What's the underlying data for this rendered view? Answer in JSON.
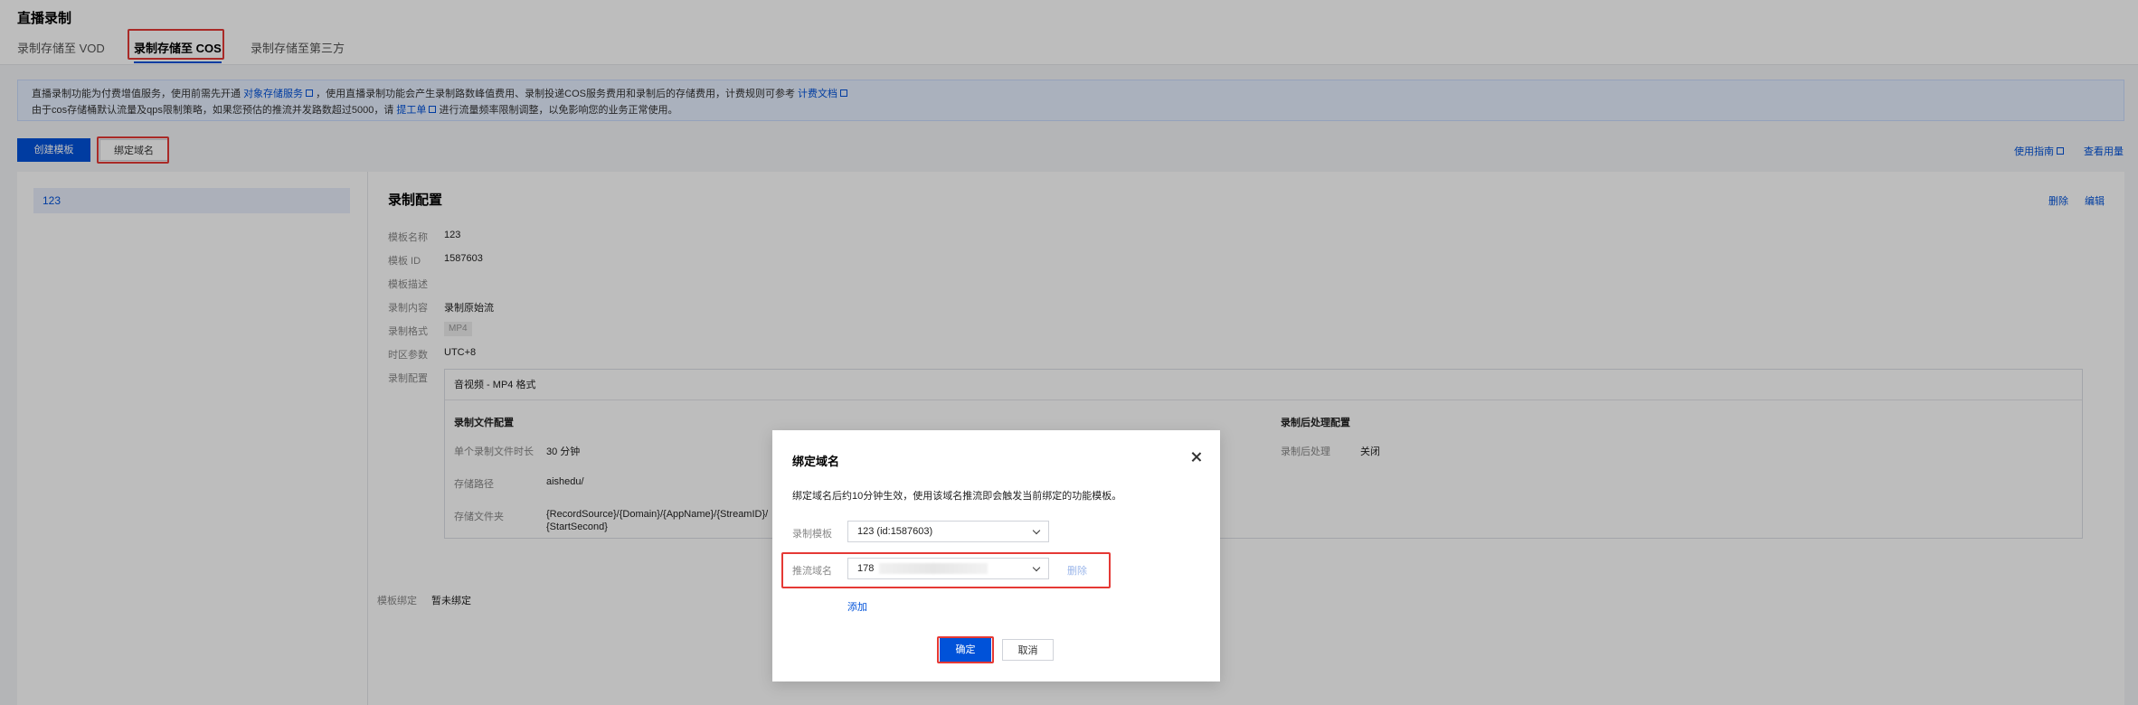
{
  "page": {
    "title": "直播录制",
    "tabs": [
      {
        "label": "录制存储至 VOD"
      },
      {
        "label": "录制存储至 COS"
      },
      {
        "label": "录制存储至第三方"
      }
    ]
  },
  "notice": {
    "line1_a": "直播录制功能为付费增值服务，使用前需先开通",
    "line1_link1": "对象存储服务",
    "line1_b": "，使用直播录制功能会产生录制路数峰值费用、录制投递COS服务费用和录制后的存储费用，计费规则可参考",
    "line1_link2": "计费文档",
    "line2_a": "由于cos存储桶默认流量及qps限制策略，如果您预估的推流并发路数超过5000，请",
    "line2_link": "提工单",
    "line2_b": "进行流量频率限制调整，以免影响您的业务正常使用。"
  },
  "toolbar": {
    "create_template": "创建模板",
    "bind_domain": "绑定域名",
    "usage_guide": "使用指南",
    "view_usage": "查看用量"
  },
  "template_list": [
    {
      "name": "123"
    }
  ],
  "config": {
    "section_title": "录制配置",
    "delete": "删除",
    "edit": "编辑",
    "rows": [
      {
        "label": "模板名称",
        "value": "123"
      },
      {
        "label": "模板 ID",
        "value": "1587603"
      },
      {
        "label": "模板描述",
        "value": ""
      },
      {
        "label": "录制内容",
        "value": "录制原始流"
      },
      {
        "label": "录制格式",
        "value": "MP4"
      },
      {
        "label": "时区参数",
        "value": "UTC+8"
      },
      {
        "label": "录制配置",
        "value": ""
      }
    ],
    "card": {
      "header": "音视频 - MP4 格式",
      "file_config_title": "录制文件配置",
      "post_config_title": "录制后处理配置",
      "single_duration_label": "单个录制文件时长",
      "single_duration_value": "30 分钟",
      "storage_path_label": "存储路径",
      "storage_path_value": "aishedu/",
      "storage_file_label": "存储文件夹",
      "storage_file_value_1": "{RecordSource}/{Domain}/{AppName}/{StreamID}/",
      "storage_file_value_2": "{StartSecond}",
      "post_process_label": "录制后处理",
      "post_process_value": "关闭"
    },
    "binding_label": "模板绑定",
    "binding_value": "暂未绑定"
  },
  "modal": {
    "title": "绑定域名",
    "description": "绑定域名后约10分钟生效，使用该域名推流即会触发当前绑定的功能模板。",
    "template_label": "录制模板",
    "template_value": "123 (id:1587603)",
    "domain_label": "推流域名",
    "domain_value": "178",
    "remove": "删除",
    "add": "添加",
    "confirm": "确定",
    "cancel": "取消"
  },
  "colors": {
    "primary": "#0052d9",
    "highlight_box": "#e53935"
  }
}
